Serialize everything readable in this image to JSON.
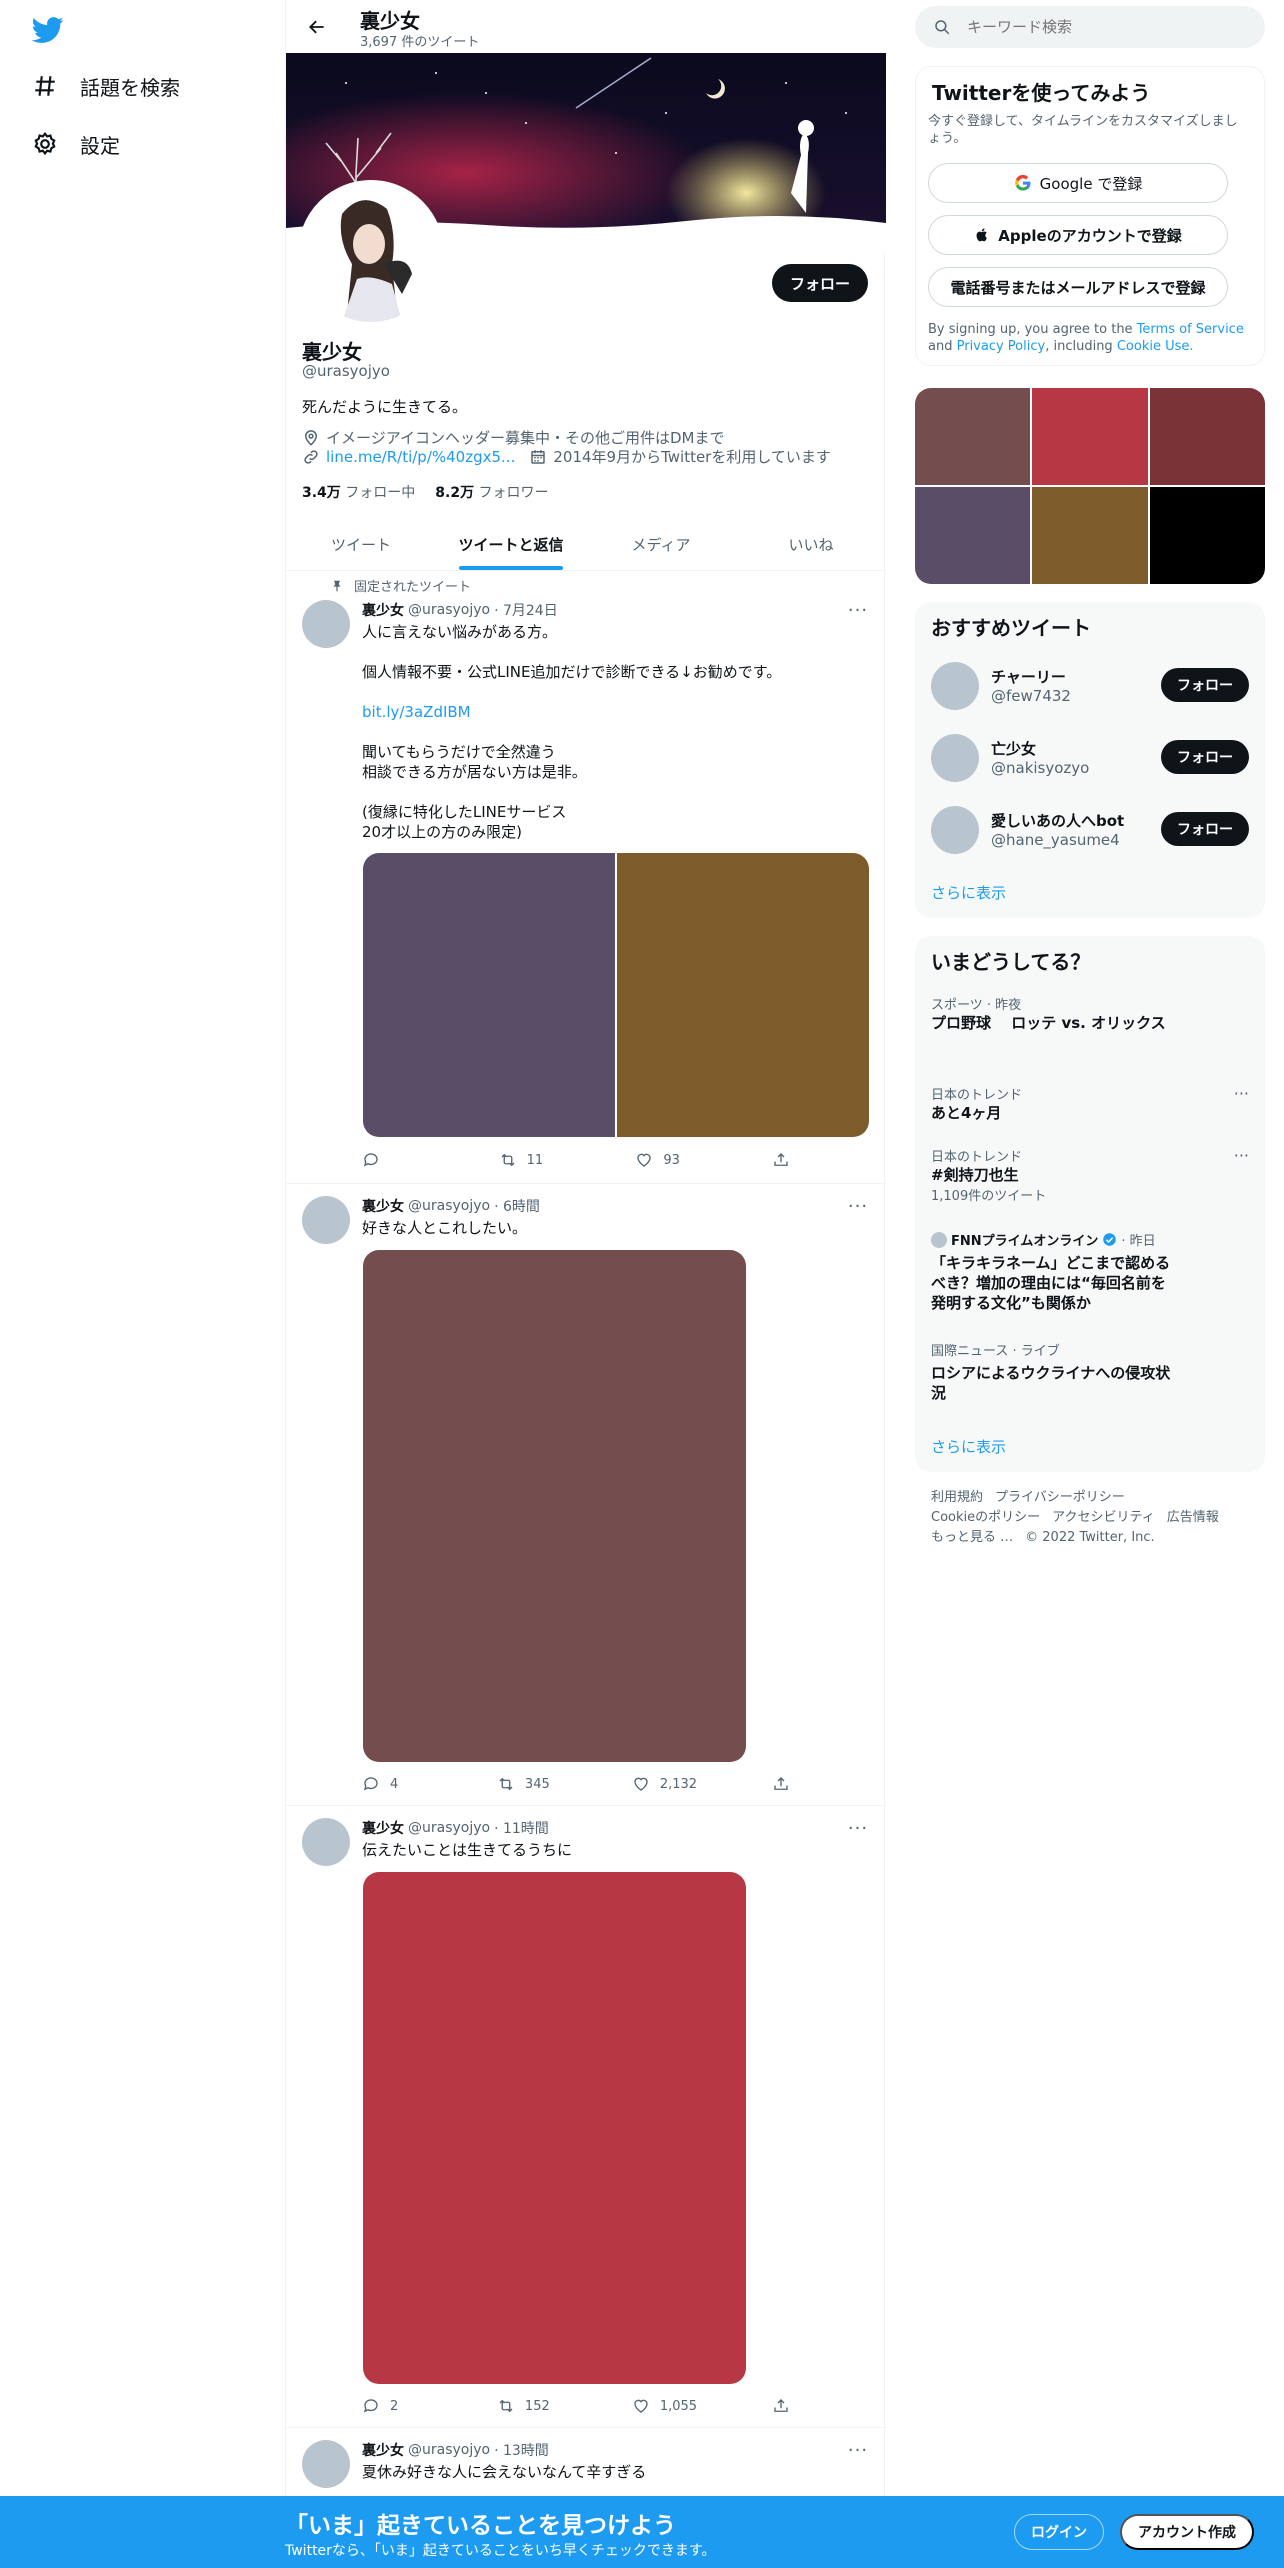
{
  "nav": {
    "explore_label": "話題を検索",
    "settings_label": "設定"
  },
  "header": {
    "title": "裏少女",
    "tweet_count": "3,697 件のツイート"
  },
  "profile": {
    "name": "裏少女",
    "handle": "@urasyojyo",
    "bio": "死んだように生きてる。",
    "location": "イメージアイコンヘッダー募集中・その他ご用件はDMまで",
    "link": "line.me/R/ti/p/%40zgx5...",
    "joined": "2014年9月からTwitterを利用しています",
    "following_count": "3.4万",
    "following_label": "フォロー中",
    "followers_count": "8.2万",
    "followers_label": "フォロワー",
    "follow_label": "フォロー"
  },
  "tabs": [
    {
      "label": "ツイート"
    },
    {
      "label": "ツイートと返信"
    },
    {
      "label": "メディア"
    },
    {
      "label": "いいね"
    }
  ],
  "pinned_label": "固定されたツイート",
  "tweets": [
    {
      "name": "裏少女",
      "handle": "@urasyojyo",
      "time": "· 7月24日",
      "text1": "人に言えない悩みがある方。\n\n個人情報不要・公式LINE追加だけで診断できる↓お勧めです。",
      "link": "bit.ly/3aZdIBM",
      "text2": "聞いてもらうだけで全然違う\n相談できる方が居ない方は是非。\n\n(復縁に特化したLINEサービス\n20才以上の方のみ限定)",
      "retweets": "11",
      "likes": "93",
      "replies": "",
      "media_colors": [
        "#5a4d67",
        "#7e5b2b"
      ]
    },
    {
      "name": "裏少女",
      "handle": "@urasyojyo",
      "time": "· 6時間",
      "text1": "好きな人とこれしたい。",
      "replies": "4",
      "retweets": "345",
      "likes": "2,132",
      "media_colors": [
        "#744e4f"
      ]
    },
    {
      "name": "裏少女",
      "handle": "@urasyojyo",
      "time": "· 11時間",
      "text1": "伝えたいことは生きてるうちに",
      "replies": "2",
      "retweets": "152",
      "likes": "1,055",
      "media_colors": [
        "#b73744"
      ]
    },
    {
      "name": "裏少女",
      "handle": "@urasyojyo",
      "time": "· 13時間",
      "text1": "夏休み好きな人に会えないなんて辛すぎる"
    }
  ],
  "right": {
    "search_placeholder": "キーワード検索",
    "signup": {
      "title": "Twitterを使ってみよう",
      "desc": "今すぐ登録して、タイムラインをカスタマイズしましょう。",
      "google": "Google で登録",
      "apple": "Appleのアカウントで登録",
      "phone": "電話番号またはメールアドレスで登録",
      "terms_pre": "By signing up, you agree to the",
      "terms": "Terms of Service",
      "and": "and",
      "privacy": "Privacy Policy",
      "including": ", including",
      "cookie": "Cookie Use."
    },
    "media_grid_colors": [
      "#744e4f",
      "#b73744",
      "#7a3337",
      "#5a4d67",
      "#7e5b2b",
      "#000000"
    ],
    "recommend": {
      "title": "おすすめツイート",
      "users": [
        {
          "name": "チャーリー",
          "handle": "@few7432"
        },
        {
          "name": "亡少女",
          "handle": "@nakisyozyo"
        },
        {
          "name": "愛しいあの人へbot",
          "handle": "@hane_yasume4"
        }
      ],
      "follow_label": "フォロー",
      "more": "さらに表示"
    },
    "trends": {
      "title": "いまどうしてる？",
      "items": [
        {
          "category": "スポーツ · 昨夜",
          "name": "プロ野球　 ロッテ vs. オリックス"
        },
        {
          "category": "日本のトレンド",
          "name": "あと4ヶ月"
        },
        {
          "category": "日本のトレンド",
          "name": "#剣持刀也生",
          "count": "1,109件のツイート"
        },
        {
          "source": "FNNプライムオンライン",
          "time": "· 昨日",
          "name": "「キラキラネーム」どこまで認めるべき？増加の理由には“毎回名前を発明する文化”も関係か"
        },
        {
          "category": "国際ニュース · ライブ",
          "name": "ロシアによるウクライナへの侵攻状況"
        }
      ],
      "more": "さらに表示"
    },
    "footer": {
      "terms": "利用規約",
      "privacy": "プライバシーポリシー",
      "cookie": "Cookieのポリシー",
      "accessibility": "アクセシビリティ",
      "ads": "広告情報",
      "more": "もっと見る …",
      "copyright": "© 2022 Twitter, Inc."
    }
  },
  "bottom": {
    "title": "「いま」起きていることを見つけよう",
    "subtitle": "Twitterなら、「いま」起きていることをいち早くチェックできます。",
    "login": "ログイン",
    "signup": "アカウント作成"
  },
  "colors": {
    "accent": "#1d9bf0",
    "text": "#0f1419",
    "muted": "#536471"
  }
}
